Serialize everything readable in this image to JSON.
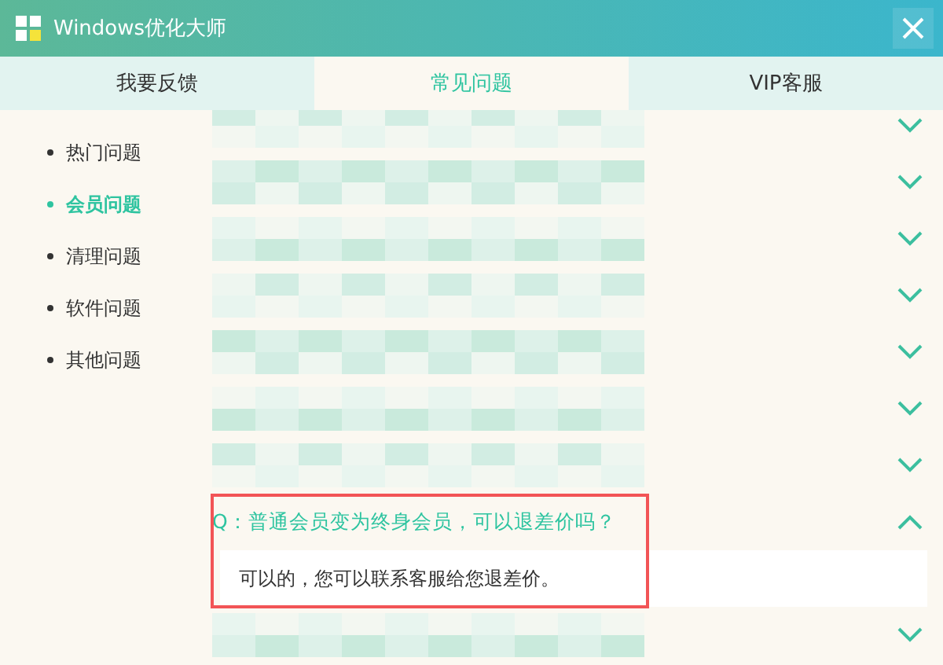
{
  "window": {
    "title": "Windows优化大师"
  },
  "tabs": [
    {
      "label": "我要反馈",
      "selected": false
    },
    {
      "label": "常见问题",
      "selected": true
    },
    {
      "label": "VIP客服",
      "selected": false
    }
  ],
  "sidebar": {
    "items": [
      {
        "label": "热门问题",
        "selected": false
      },
      {
        "label": "会员问题",
        "selected": true
      },
      {
        "label": "清理问题",
        "selected": false
      },
      {
        "label": "软件问题",
        "selected": false
      },
      {
        "label": "其他问题",
        "selected": false
      }
    ]
  },
  "faq": [
    {
      "kind": "blurred",
      "expanded": false
    },
    {
      "kind": "blurred",
      "expanded": false
    },
    {
      "kind": "blurred",
      "expanded": false
    },
    {
      "kind": "blurred",
      "expanded": false
    },
    {
      "kind": "blurred",
      "expanded": false
    },
    {
      "kind": "blurred",
      "expanded": false
    },
    {
      "kind": "blurred",
      "expanded": false
    },
    {
      "kind": "question",
      "expanded": true,
      "highlighted": true,
      "question": "Q：普通会员变为终身会员，可以退差价吗？",
      "answer": "可以的，您可以联系客服给您退差价。"
    },
    {
      "kind": "blurred",
      "expanded": false
    }
  ]
}
